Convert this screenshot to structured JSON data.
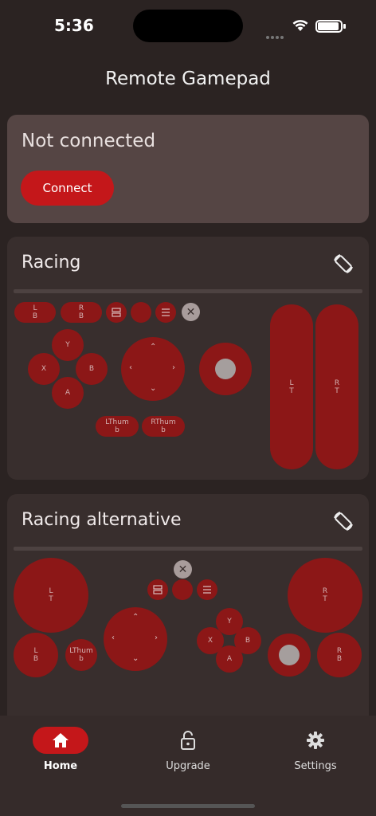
{
  "status_bar": {
    "time": "5:36"
  },
  "app": {
    "title": "Remote Gamepad"
  },
  "connection": {
    "status": "Not connected",
    "connect_label": "Connect"
  },
  "layouts": [
    {
      "title": "Racing",
      "buttons": {
        "lb": "L\nB",
        "rb": "R\nB",
        "lt": "L\nT",
        "rt": "R\nT",
        "y": "Y",
        "x": "X",
        "b": "B",
        "a": "A",
        "lthumb": "LThum\nb",
        "rthumb": "RThum\nb",
        "close": "✕"
      }
    },
    {
      "title": "Racing alternative",
      "buttons": {
        "lt": "L\nT",
        "rt": "R\nT",
        "lb": "L\nB",
        "rb": "R\nB",
        "lthumb": "LThum\nb",
        "y": "Y",
        "x": "X",
        "b": "B",
        "a": "A",
        "close": "✕"
      }
    }
  ],
  "nav": {
    "items": [
      {
        "label": "Home",
        "icon": "home-icon",
        "active": true
      },
      {
        "label": "Upgrade",
        "icon": "lock-open-icon",
        "active": false
      },
      {
        "label": "Settings",
        "icon": "gear-icon",
        "active": false
      }
    ]
  },
  "colors": {
    "accent": "#c4171a",
    "pad": "#8c1717",
    "background": "#2b2322"
  }
}
